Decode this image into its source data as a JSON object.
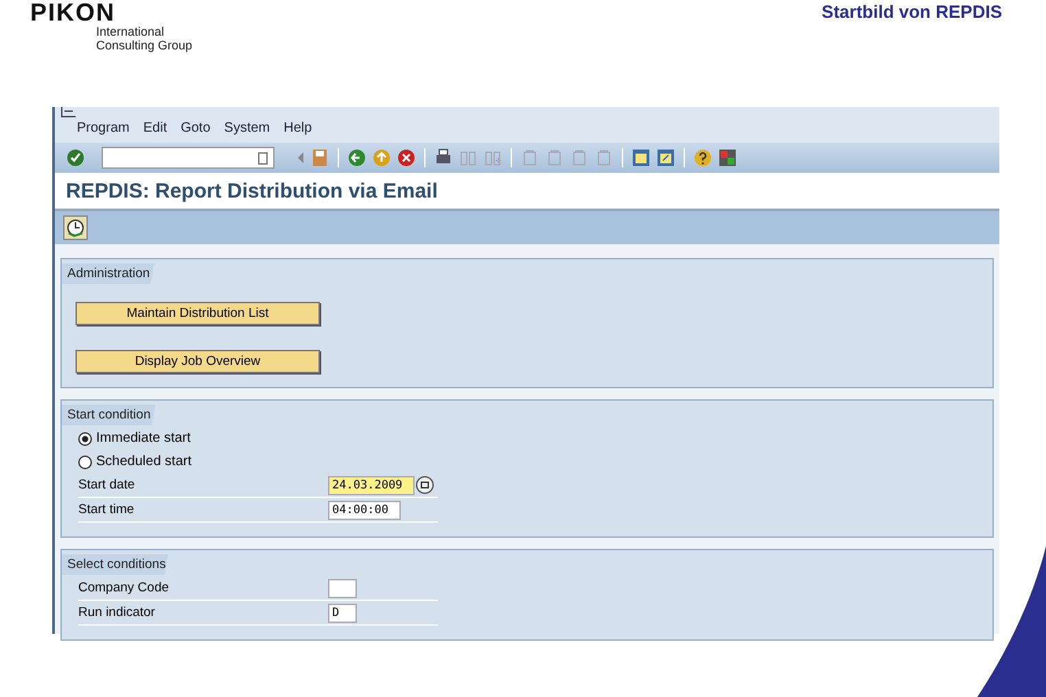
{
  "header": {
    "logo": {
      "name": "PIKON",
      "tagline_1": "International",
      "tagline_2": "Consulting Group"
    },
    "slide_title": "Startbild von REPDIS"
  },
  "window": {
    "menu": [
      "Program",
      "Edit",
      "Goto",
      "System",
      "Help"
    ],
    "title": "REPDIS: Report Distribution via Email"
  },
  "sections": [
    {
      "kind": "buttons",
      "title": "Administration",
      "buttons": [
        "Maintain Distribution List",
        "Display Job Overview"
      ]
    },
    {
      "kind": "form",
      "title": "Start condition",
      "radios": [
        {
          "label": "Immediate start",
          "selected": true
        },
        {
          "label": "Scheduled start",
          "selected": false
        }
      ],
      "fields": [
        {
          "label": "Start date",
          "value": "24.03.2009",
          "highlighted": true,
          "calendar": true
        },
        {
          "label": "Start time",
          "value": "04:00:00",
          "highlighted": false,
          "calendar": false
        }
      ]
    },
    {
      "kind": "form",
      "title": "Select conditions",
      "fields": [
        {
          "label": "Company Code",
          "highlighted": false,
          "calendar": false
        },
        {
          "label": "Run indicator",
          "value": "D",
          "highlighted": false,
          "calendar": false
        }
      ]
    }
  ]
}
